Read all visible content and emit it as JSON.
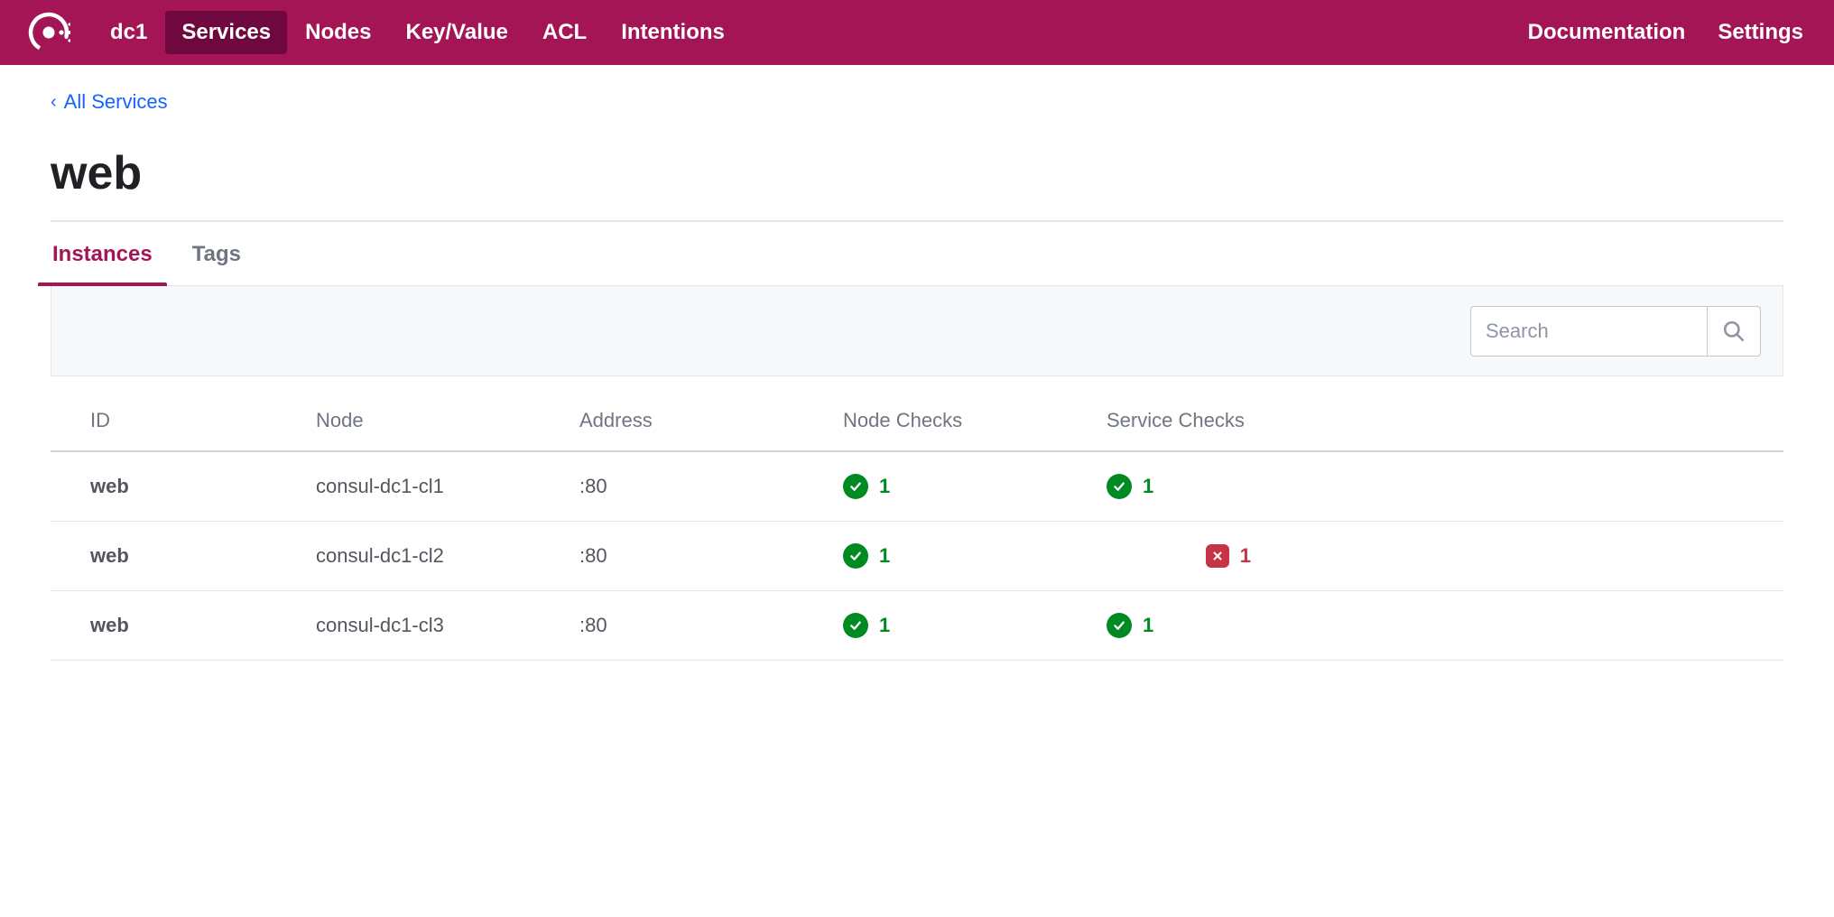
{
  "nav": {
    "dc": "dc1",
    "items": [
      {
        "label": "Services",
        "active": true
      },
      {
        "label": "Nodes",
        "active": false
      },
      {
        "label": "Key/Value",
        "active": false
      },
      {
        "label": "ACL",
        "active": false
      },
      {
        "label": "Intentions",
        "active": false
      }
    ],
    "right": {
      "docs": "Documentation",
      "settings": "Settings"
    }
  },
  "breadcrumb": {
    "back_label": "All Services"
  },
  "page": {
    "title": "web"
  },
  "tabs": [
    {
      "label": "Instances",
      "active": true
    },
    {
      "label": "Tags",
      "active": false
    }
  ],
  "search": {
    "placeholder": "Search",
    "value": ""
  },
  "table": {
    "columns": {
      "id": "ID",
      "node": "Node",
      "address": "Address",
      "node_checks": "Node Checks",
      "service_checks": "Service Checks"
    },
    "rows": [
      {
        "id": "web",
        "node": "consul-dc1-cl1",
        "address": ":80",
        "node_checks": {
          "status": "pass",
          "count": 1
        },
        "service_checks": {
          "status": "pass",
          "count": 1
        }
      },
      {
        "id": "web",
        "node": "consul-dc1-cl2",
        "address": ":80",
        "node_checks": {
          "status": "pass",
          "count": 1
        },
        "service_checks": {
          "status": "fail",
          "count": 1
        }
      },
      {
        "id": "web",
        "node": "consul-dc1-cl3",
        "address": ":80",
        "node_checks": {
          "status": "pass",
          "count": 1
        },
        "service_checks": {
          "status": "pass",
          "count": 1
        }
      }
    ]
  },
  "colors": {
    "brand": "#a31555",
    "brand_dark": "#6f083e",
    "link": "#1563ff",
    "pass": "#008a22",
    "fail": "#c73445"
  }
}
